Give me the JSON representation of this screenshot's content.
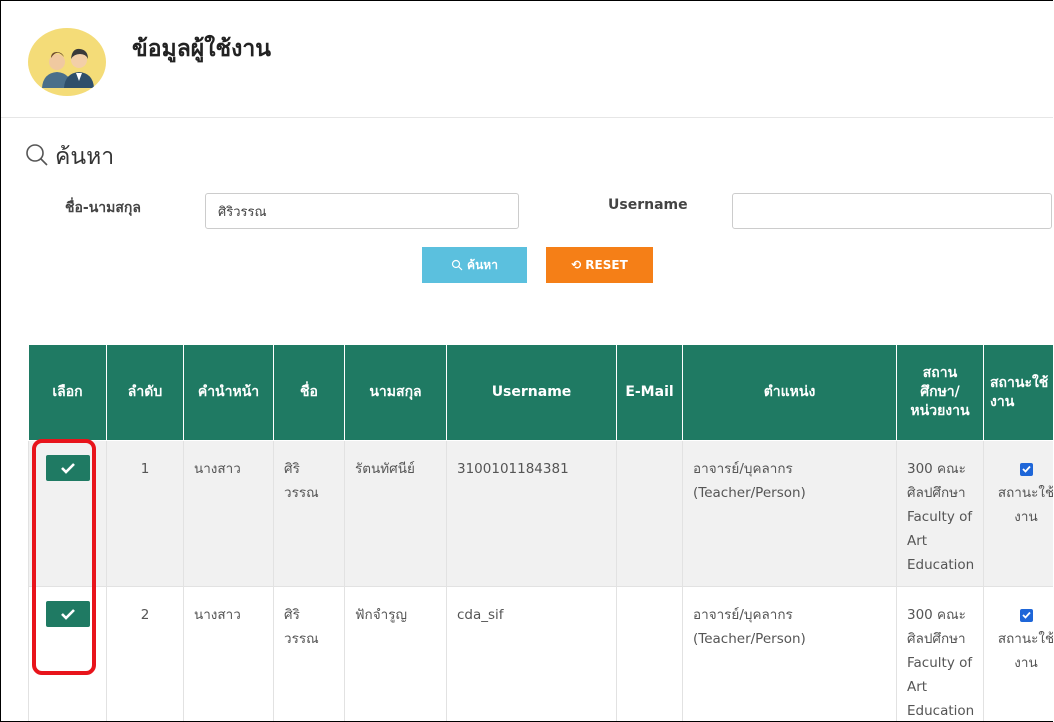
{
  "header": {
    "title": "ข้อมูลผู้ใช้งาน",
    "avatar_icon": "users-avatar-icon"
  },
  "search": {
    "heading": "ค้นหา",
    "name_label": "ชื่อ-นามสกุล",
    "name_value": "ศิริวรรณ",
    "username_label": "Username",
    "username_value": "",
    "search_button": "ค้นหา",
    "reset_button": "RESET"
  },
  "colors": {
    "table_header": "#1f7a63",
    "search_button": "#5bc0de",
    "reset_button": "#f57f17",
    "highlight": "#e8141b"
  },
  "table": {
    "columns": [
      "เลือก",
      "ลำดับ",
      "คำนำหน้า",
      "ชื่อ",
      "นามสกุล",
      "Username",
      "E-Mail",
      "ตำแหน่ง",
      "สถานศึกษา/หน่วยงาน",
      "สถานะใช้งาน"
    ],
    "rows": [
      {
        "no": "1",
        "prefix": "นางสาว",
        "firstname": "ศิริวรรณ",
        "lastname": "รัตนทัศนีย์",
        "username": "3100101184381",
        "email": "",
        "position": "อาจารย์/บุคลากร (Teacher/Person)",
        "org": "300 คณะศิลปศึกษา Faculty of Art Education",
        "status_label": "สถานะใช้งาน",
        "status_checked": true
      },
      {
        "no": "2",
        "prefix": "นางสาว",
        "firstname": "ศิริวรรณ",
        "lastname": "ฟักจำรูญ",
        "username": "cda_sif",
        "email": "",
        "position": "อาจารย์/บุคลากร (Teacher/Person)",
        "org": "300 คณะศิลปศึกษา Faculty of Art Education",
        "status_label": "สถานะใช้งาน",
        "status_checked": true
      }
    ]
  }
}
